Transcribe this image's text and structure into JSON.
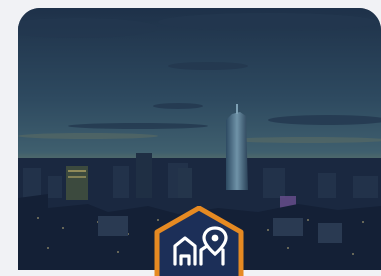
{
  "card": {
    "image_subject": "city-skyline-at-dusk",
    "badge_icon": "city-map-pin-icon",
    "colors": {
      "sky_top": "#1f3550",
      "sky_mid": "#3a5a6c",
      "horizon": "#6f7d67",
      "city": "#0f1b30",
      "badge_fill": "#1c2f58",
      "badge_border": "#e68a22",
      "icon": "#ffffff"
    }
  }
}
